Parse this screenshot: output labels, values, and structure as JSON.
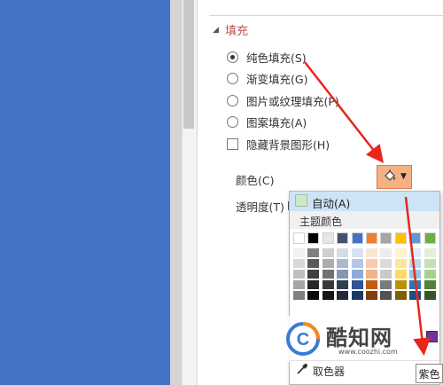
{
  "fill_section": {
    "title": "填充",
    "options": [
      {
        "label": "纯色填充(S)",
        "selected": true
      },
      {
        "label": "渐变填充(G)",
        "selected": false
      },
      {
        "label": "图片或纹理填充(P)",
        "selected": false
      },
      {
        "label": "图案填充(A)",
        "selected": false
      }
    ],
    "hide_background": {
      "label": "隐藏背景图形(H)",
      "checked": false
    },
    "color_label": "颜色(C)",
    "transparency_label": "透明度(T)"
  },
  "color_dropdown": {
    "auto_label": "自动(A)",
    "theme_colors_label": "主题颜色",
    "eyedropper_label": "取色器",
    "recent_color": "#7030a0",
    "theme_top_row": [
      "#ffffff",
      "#000000",
      "#e7e6e6",
      "#44546a",
      "#4472c4",
      "#ed7d31",
      "#a5a5a5",
      "#ffc000",
      "#5b9bd5",
      "#70ad47"
    ],
    "theme_shades": [
      [
        "#f2f2f2",
        "#7f7f7f",
        "#d0cece",
        "#d6dce4",
        "#d9e2f3",
        "#fbe5d5",
        "#ededed",
        "#fff2cc",
        "#deebf6",
        "#e2efd9"
      ],
      [
        "#d8d8d8",
        "#595959",
        "#aeabab",
        "#adb9ca",
        "#b4c6e7",
        "#f7cbac",
        "#dbdbdb",
        "#fee599",
        "#bdd7ee",
        "#c5e0b3"
      ],
      [
        "#bfbfbf",
        "#3f3f3f",
        "#757070",
        "#8496b0",
        "#8eaadb",
        "#f4b183",
        "#c9c9c9",
        "#ffd965",
        "#9cc3e5",
        "#a8d08d"
      ],
      [
        "#a5a5a5",
        "#262626",
        "#3a3838",
        "#323f4f",
        "#2f5496",
        "#c55a11",
        "#7b7b7b",
        "#bf9000",
        "#2e75b5",
        "#538135"
      ],
      [
        "#7f7f7f",
        "#0c0c0c",
        "#171616",
        "#222a35",
        "#1e3864",
        "#833c0b",
        "#525252",
        "#7f6000",
        "#1f4e79",
        "#375623"
      ]
    ]
  },
  "tooltip": "紫色",
  "watermark": {
    "brand": "酷知网",
    "url": "www.coozhi.com"
  },
  "colors": {
    "slide_blue": "#4472c4",
    "accent_red": "#e8261c",
    "button_orange": "#f4b183"
  }
}
